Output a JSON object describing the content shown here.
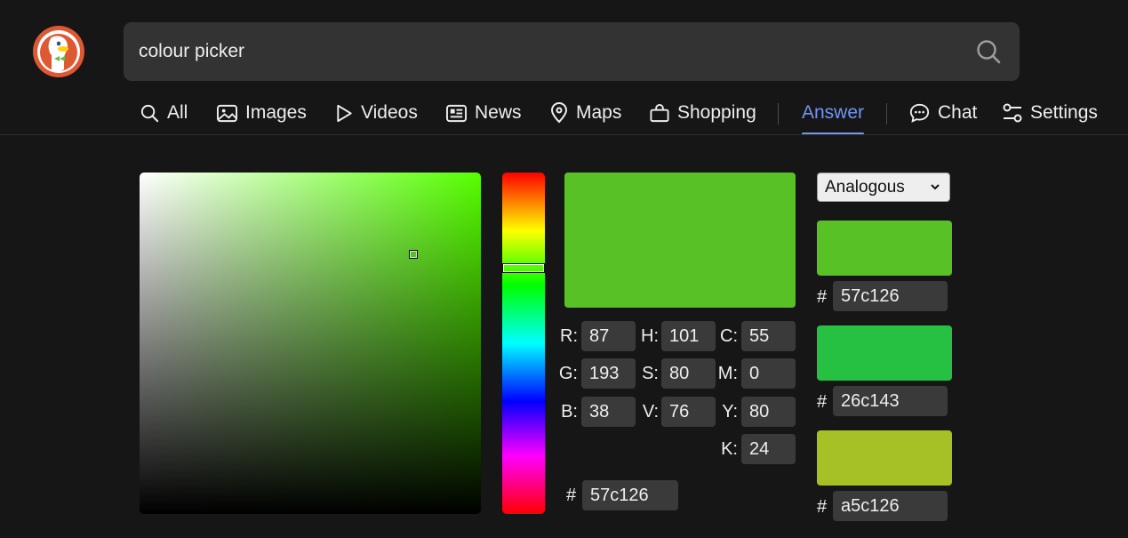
{
  "search": {
    "query": "colour picker"
  },
  "nav": {
    "all": "All",
    "images": "Images",
    "videos": "Videos",
    "news": "News",
    "maps": "Maps",
    "shopping": "Shopping",
    "answer": "Answer",
    "chat": "Chat",
    "settings": "Settings"
  },
  "picker": {
    "selected_color": "#57c126",
    "rgb": {
      "r_label": "R:",
      "r": "87",
      "g_label": "G:",
      "g": "193",
      "b_label": "B:",
      "b": "38"
    },
    "hsv": {
      "h_label": "H:",
      "h": "101",
      "s_label": "S:",
      "s": "80",
      "v_label": "V:",
      "v": "76"
    },
    "cmyk": {
      "c_label": "C:",
      "c": "55",
      "m_label": "M:",
      "m": "0",
      "y_label": "Y:",
      "y": "80",
      "k_label": "K:",
      "k": "24"
    },
    "hash_symbol": "#",
    "hex": "57c126"
  },
  "scheme": {
    "selected": "Analogous",
    "colors": [
      {
        "hex": "57c126",
        "color": "#57c126"
      },
      {
        "hex": "26c143",
        "color": "#26c143"
      },
      {
        "hex": "a5c126",
        "color": "#a5c126"
      }
    ]
  },
  "colors": {
    "accent": "#7295f6",
    "background": "#161616",
    "field": "#3a3a3a"
  }
}
